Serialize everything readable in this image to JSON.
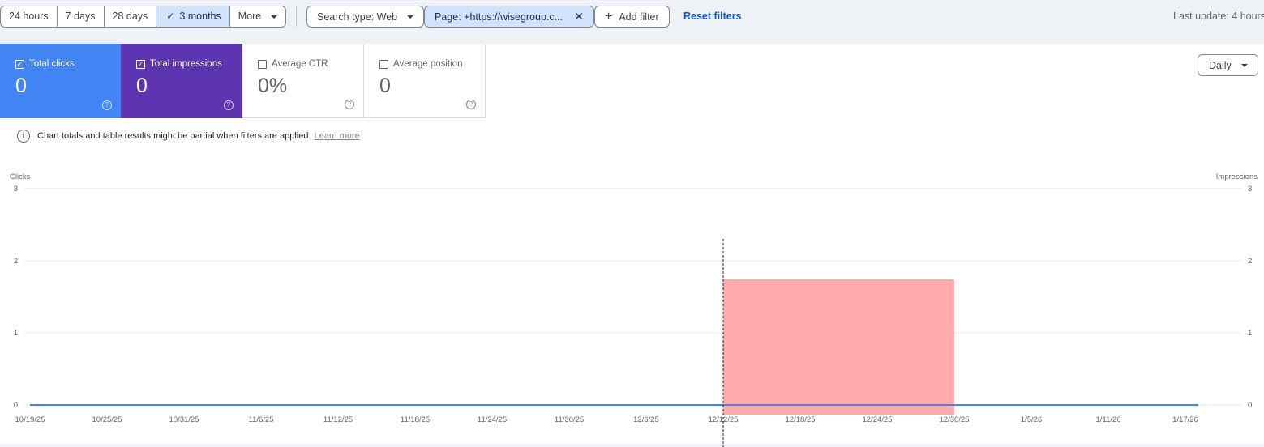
{
  "date_range": {
    "options": [
      "24 hours",
      "7 days",
      "28 days",
      "3 months",
      "More"
    ],
    "selected": "3 months"
  },
  "filters": {
    "search_type": "Search type: Web",
    "page": "Page: +https://wisegroup.c...",
    "add_filter": "Add filter",
    "reset": "Reset filters"
  },
  "last_update": "Last update: 4 hours",
  "metrics": [
    {
      "label": "Total clicks",
      "value": "0",
      "checked": true
    },
    {
      "label": "Total impressions",
      "value": "0",
      "checked": true
    },
    {
      "label": "Average CTR",
      "value": "0%",
      "checked": false
    },
    {
      "label": "Average position",
      "value": "0",
      "checked": false
    }
  ],
  "granularity": "Daily",
  "notice": {
    "text": "Chart totals and table results might be partial when filters are applied.",
    "link": "Learn more"
  },
  "colors": {
    "clicks": "#4285f4",
    "impressions": "#5e35b1",
    "highlight": "#ffabab",
    "link": "#0b57d0"
  },
  "icons": [
    "checkmark-icon",
    "caret-down-icon",
    "close-icon",
    "plus-icon",
    "help-icon",
    "info-icon"
  ],
  "chart_data": {
    "type": "line",
    "y_left_label": "Clicks",
    "y_right_label": "Impressions",
    "ylim": [
      0,
      3
    ],
    "y_ticks": [
      "0",
      "1",
      "2",
      "3"
    ],
    "x_ticks": [
      "10/19/25",
      "10/25/25",
      "10/31/25",
      "11/6/25",
      "11/12/25",
      "11/18/25",
      "11/24/25",
      "11/30/25",
      "12/6/25",
      "12/12/25",
      "12/18/25",
      "12/24/25",
      "12/30/25",
      "1/5/26",
      "1/11/26",
      "1/17/26"
    ],
    "x_range": [
      "10/19/25",
      "1/18/26"
    ],
    "series": [
      {
        "name": "Clicks",
        "values": [
          0,
          0
        ]
      },
      {
        "name": "Impressions",
        "values": [
          0,
          0
        ]
      }
    ],
    "highlight_range": [
      "12/12/25",
      "12/30/25"
    ],
    "marker_date": "12/12/25",
    "grid": true
  }
}
